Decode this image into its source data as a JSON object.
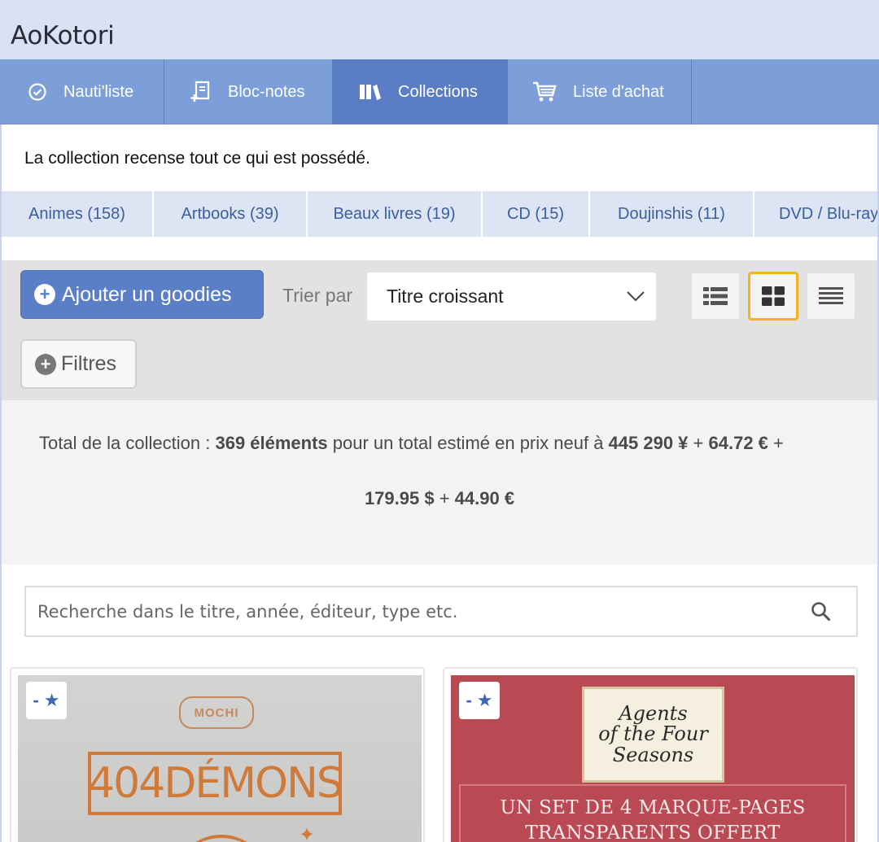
{
  "app": {
    "title": "AoKotori"
  },
  "nav": [
    {
      "label": "Nauti'liste",
      "icon": "check-circle-icon",
      "active": false
    },
    {
      "label": "Bloc-notes",
      "icon": "notepad-add-icon",
      "active": false
    },
    {
      "label": "Collections",
      "icon": "books-icon",
      "active": true
    },
    {
      "label": "Liste d'achat",
      "icon": "cart-icon",
      "active": false
    }
  ],
  "intro": "La collection recense tout ce qui est possédé.",
  "categories": [
    "Animes (158)",
    "Artbooks (39)",
    "Beaux livres (19)",
    "CD (15)",
    "Doujinshis (11)",
    "DVD / Blu-ray"
  ],
  "toolbar": {
    "add_label": "Ajouter un goodies",
    "sort_label": "Trier par",
    "sort_value": "Titre croissant",
    "filters_label": "Filtres",
    "views": [
      "list-view-icon",
      "grid-view-icon",
      "compact-list-icon"
    ],
    "active_view": "grid-view-icon"
  },
  "summary": {
    "prefix": "Total de la collection : ",
    "count": "369 éléments",
    "middle": " pour un total estimé en prix neuf à ",
    "yen": "445 290 ¥",
    "plus1": " + ",
    "eur1": "64.72 €",
    "plus2": " +",
    "usd": "179.95 $",
    "plus3": " + ",
    "eur2": "44.90 €"
  },
  "search": {
    "placeholder": "Recherche dans le titre, année, éditeur, type etc."
  },
  "cards": [
    {
      "fav_dash": "-",
      "badge": "MOCHI",
      "title_art": "404DÉMONS"
    },
    {
      "fav_dash": "-",
      "title_line1": "Agents",
      "title_line2": "of the Four",
      "title_line3": "Seasons",
      "promo_line1": "UN SET DE 4 MARQUE-PAGES",
      "promo_line2": "TRANSPARENTS OFFERT"
    }
  ],
  "colors": {
    "header_bg": "#d9e1f4",
    "nav_bg": "#7d9fd9",
    "nav_active": "#5b7dc4",
    "accent": "#5b7fc7",
    "view_active_border": "#f5b324"
  }
}
